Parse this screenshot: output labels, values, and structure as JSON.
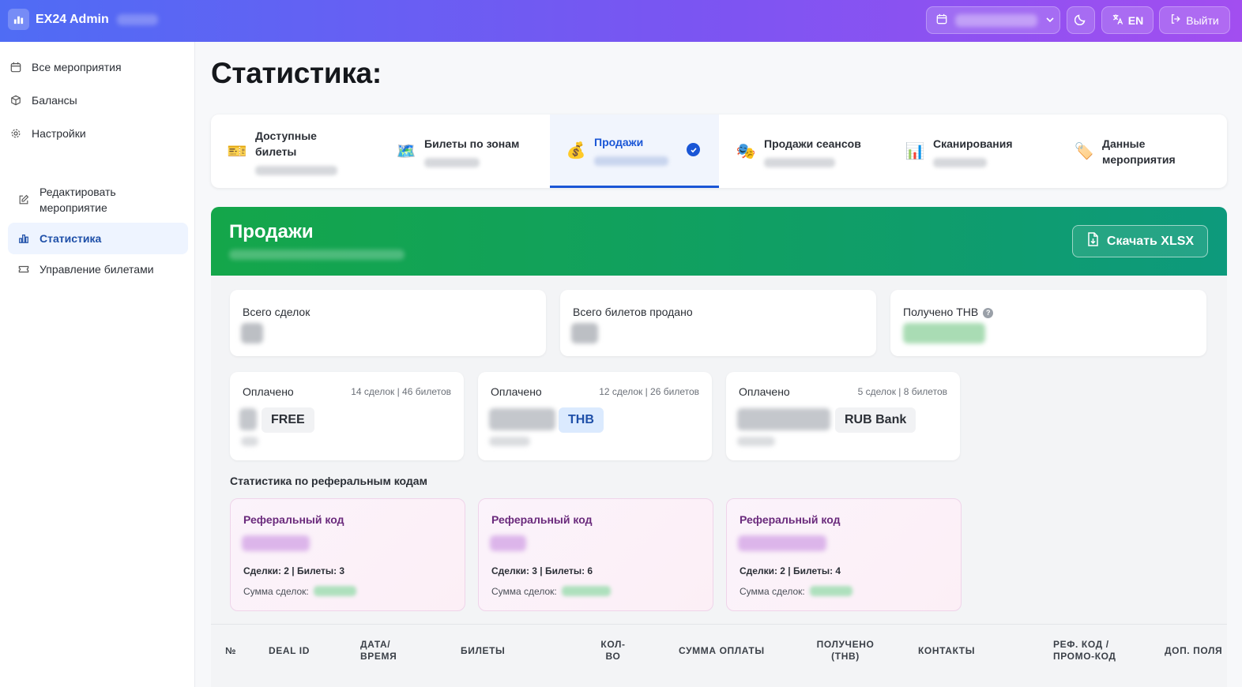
{
  "app": {
    "title": "EX24 Admin"
  },
  "topbar": {
    "lang_label": "EN",
    "logout_label": "Выйти"
  },
  "sidebar": {
    "main_items": [
      {
        "label": "Все мероприятия",
        "icon": "calendar-icon"
      },
      {
        "label": "Балансы",
        "icon": "box-icon"
      },
      {
        "label": "Настройки",
        "icon": "gear-icon"
      }
    ],
    "event_items": [
      {
        "label": "Редактировать мероприятие",
        "icon": "edit-icon"
      },
      {
        "label": "Статистика",
        "icon": "chart-icon",
        "active": true
      },
      {
        "label": "Управление билетами",
        "icon": "ticket-icon"
      }
    ]
  },
  "page": {
    "title": "Статистика:"
  },
  "tabs": [
    {
      "label": "Доступные билеты",
      "emoji": "🎫"
    },
    {
      "label": "Билеты по зонам",
      "emoji": "🗺️"
    },
    {
      "label": "Продажи",
      "emoji": "💰",
      "active": true
    },
    {
      "label": "Продажи сеансов",
      "emoji": "🎭"
    },
    {
      "label": "Сканирования",
      "emoji": "📊"
    },
    {
      "label": "Данные мероприятия",
      "emoji": "🏷️"
    }
  ],
  "sales": {
    "title": "Продажи",
    "download_label": "Скачать XLSX",
    "stats": [
      {
        "label": "Всего сделок"
      },
      {
        "label": "Всего билетов продано"
      },
      {
        "label": "Получено THB"
      }
    ],
    "payments": [
      {
        "label": "Оплачено",
        "meta": "14 сделок | 46 билетов",
        "currency": "FREE"
      },
      {
        "label": "Оплачено",
        "meta": "12 сделок | 26 билетов",
        "currency": "THB"
      },
      {
        "label": "Оплачено",
        "meta": "5 сделок | 8 билетов",
        "currency": "RUB Bank"
      }
    ],
    "ref_heading": "Статистика по реферальным кодам",
    "ref_cards": [
      {
        "title": "Реферальный код",
        "counts": "Сделки: 2  |  Билеты: 3",
        "sum_label": "Сумма сделок:"
      },
      {
        "title": "Реферальный код",
        "counts": "Сделки: 3  |  Билеты: 6",
        "sum_label": "Сумма сделок:"
      },
      {
        "title": "Реферальный код",
        "counts": "Сделки: 2  |  Билеты: 4",
        "sum_label": "Сумма сделок:"
      }
    ]
  },
  "table": {
    "headers": [
      "№",
      "Deal ID",
      "Дата/ Время",
      "Билеты",
      "Кол- во",
      "Сумма оплаты",
      "Получено (THB)",
      "Контакты",
      "Реф. код / Промо-код",
      "Доп. поля"
    ]
  },
  "colors": {
    "accent": "#1a56d6",
    "banner": "#14a64a",
    "brand_start": "#4f6cf4",
    "brand_end": "#a24ef0"
  }
}
